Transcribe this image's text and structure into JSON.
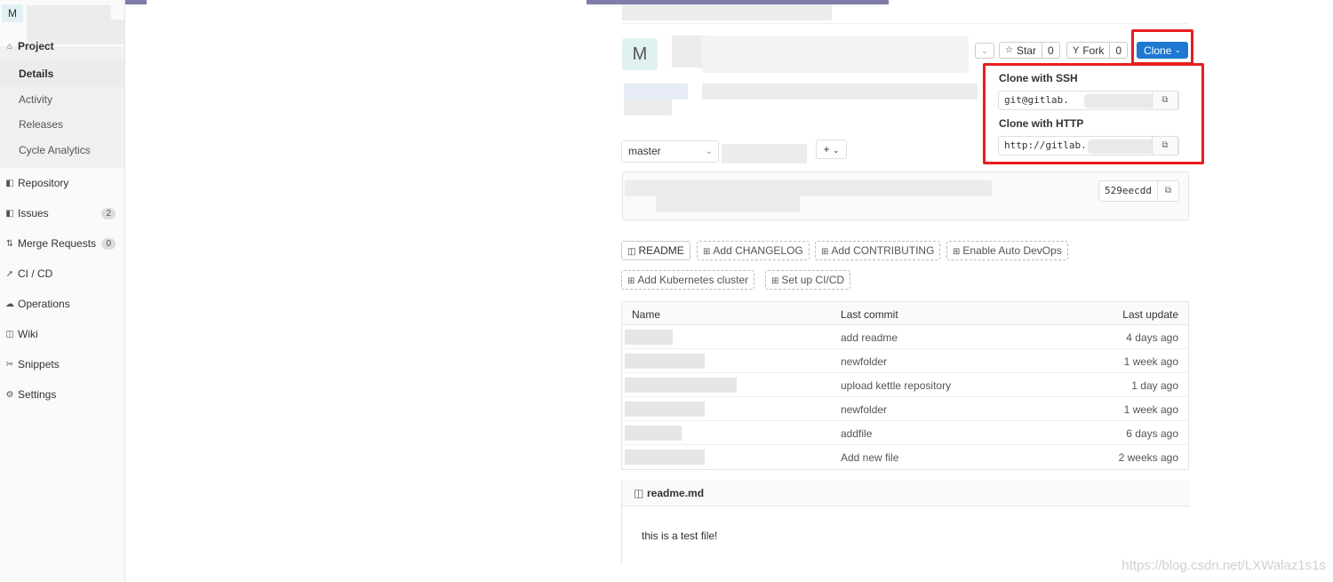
{
  "project": {
    "avatar_letter": "M",
    "large_avatar_letter": "M"
  },
  "sidebar": {
    "project_label": "Project",
    "sub_items": [
      {
        "label": "Details",
        "active": true
      },
      {
        "label": "Activity"
      },
      {
        "label": "Releases"
      },
      {
        "label": "Cycle Analytics"
      }
    ],
    "items": [
      {
        "label": "Repository",
        "icon": "repository-icon"
      },
      {
        "label": "Issues",
        "icon": "issues-icon",
        "badge": "2"
      },
      {
        "label": "Merge Requests",
        "icon": "merge-request-icon",
        "badge": "0"
      },
      {
        "label": "CI / CD",
        "icon": "rocket-icon"
      },
      {
        "label": "Operations",
        "icon": "cloud-gear-icon"
      },
      {
        "label": "Wiki",
        "icon": "book-icon"
      },
      {
        "label": "Snippets",
        "icon": "scissors-icon"
      },
      {
        "label": "Settings",
        "icon": "gear-icon"
      }
    ]
  },
  "header": {
    "star_label": "Star",
    "star_count": "0",
    "fork_label": "Fork",
    "fork_count": "0",
    "clone_label": "Clone"
  },
  "clone_dropdown": {
    "ssh_label": "Clone with SSH",
    "ssh_value": "git@gitlab.",
    "http_label": "Clone with HTTP",
    "http_value": "http://gitlab."
  },
  "branch": {
    "name": "master"
  },
  "commit": {
    "sha": "529eecdd"
  },
  "quick_actions": {
    "readme": "README",
    "add_changelog": "Add CHANGELOG",
    "add_contributing": "Add CONTRIBUTING",
    "enable_auto_devops": "Enable Auto DevOps",
    "add_kubernetes": "Add Kubernetes cluster",
    "setup_cicd": "Set up CI/CD"
  },
  "file_table": {
    "headers": {
      "name": "Name",
      "last_commit": "Last commit",
      "last_update": "Last update"
    },
    "rows": [
      {
        "commit": "add readme",
        "update": "4 days ago"
      },
      {
        "commit": "newfolder",
        "update": "1 week ago"
      },
      {
        "commit": "upload kettle repository",
        "update": "1 day ago"
      },
      {
        "commit": "newfolder",
        "update": "1 week ago"
      },
      {
        "commit": "addfile",
        "update": "6 days ago"
      },
      {
        "commit": "Add new file",
        "update": "2 weeks ago"
      }
    ]
  },
  "readme": {
    "filename": "readme.md",
    "content": "this is a test file!"
  },
  "watermark": "https://blog.csdn.net/LXWalaz1s1s",
  "colors": {
    "accent": "#1f78d1",
    "highlight_box": "#e81d1d",
    "topbar": "#7f7da8"
  }
}
